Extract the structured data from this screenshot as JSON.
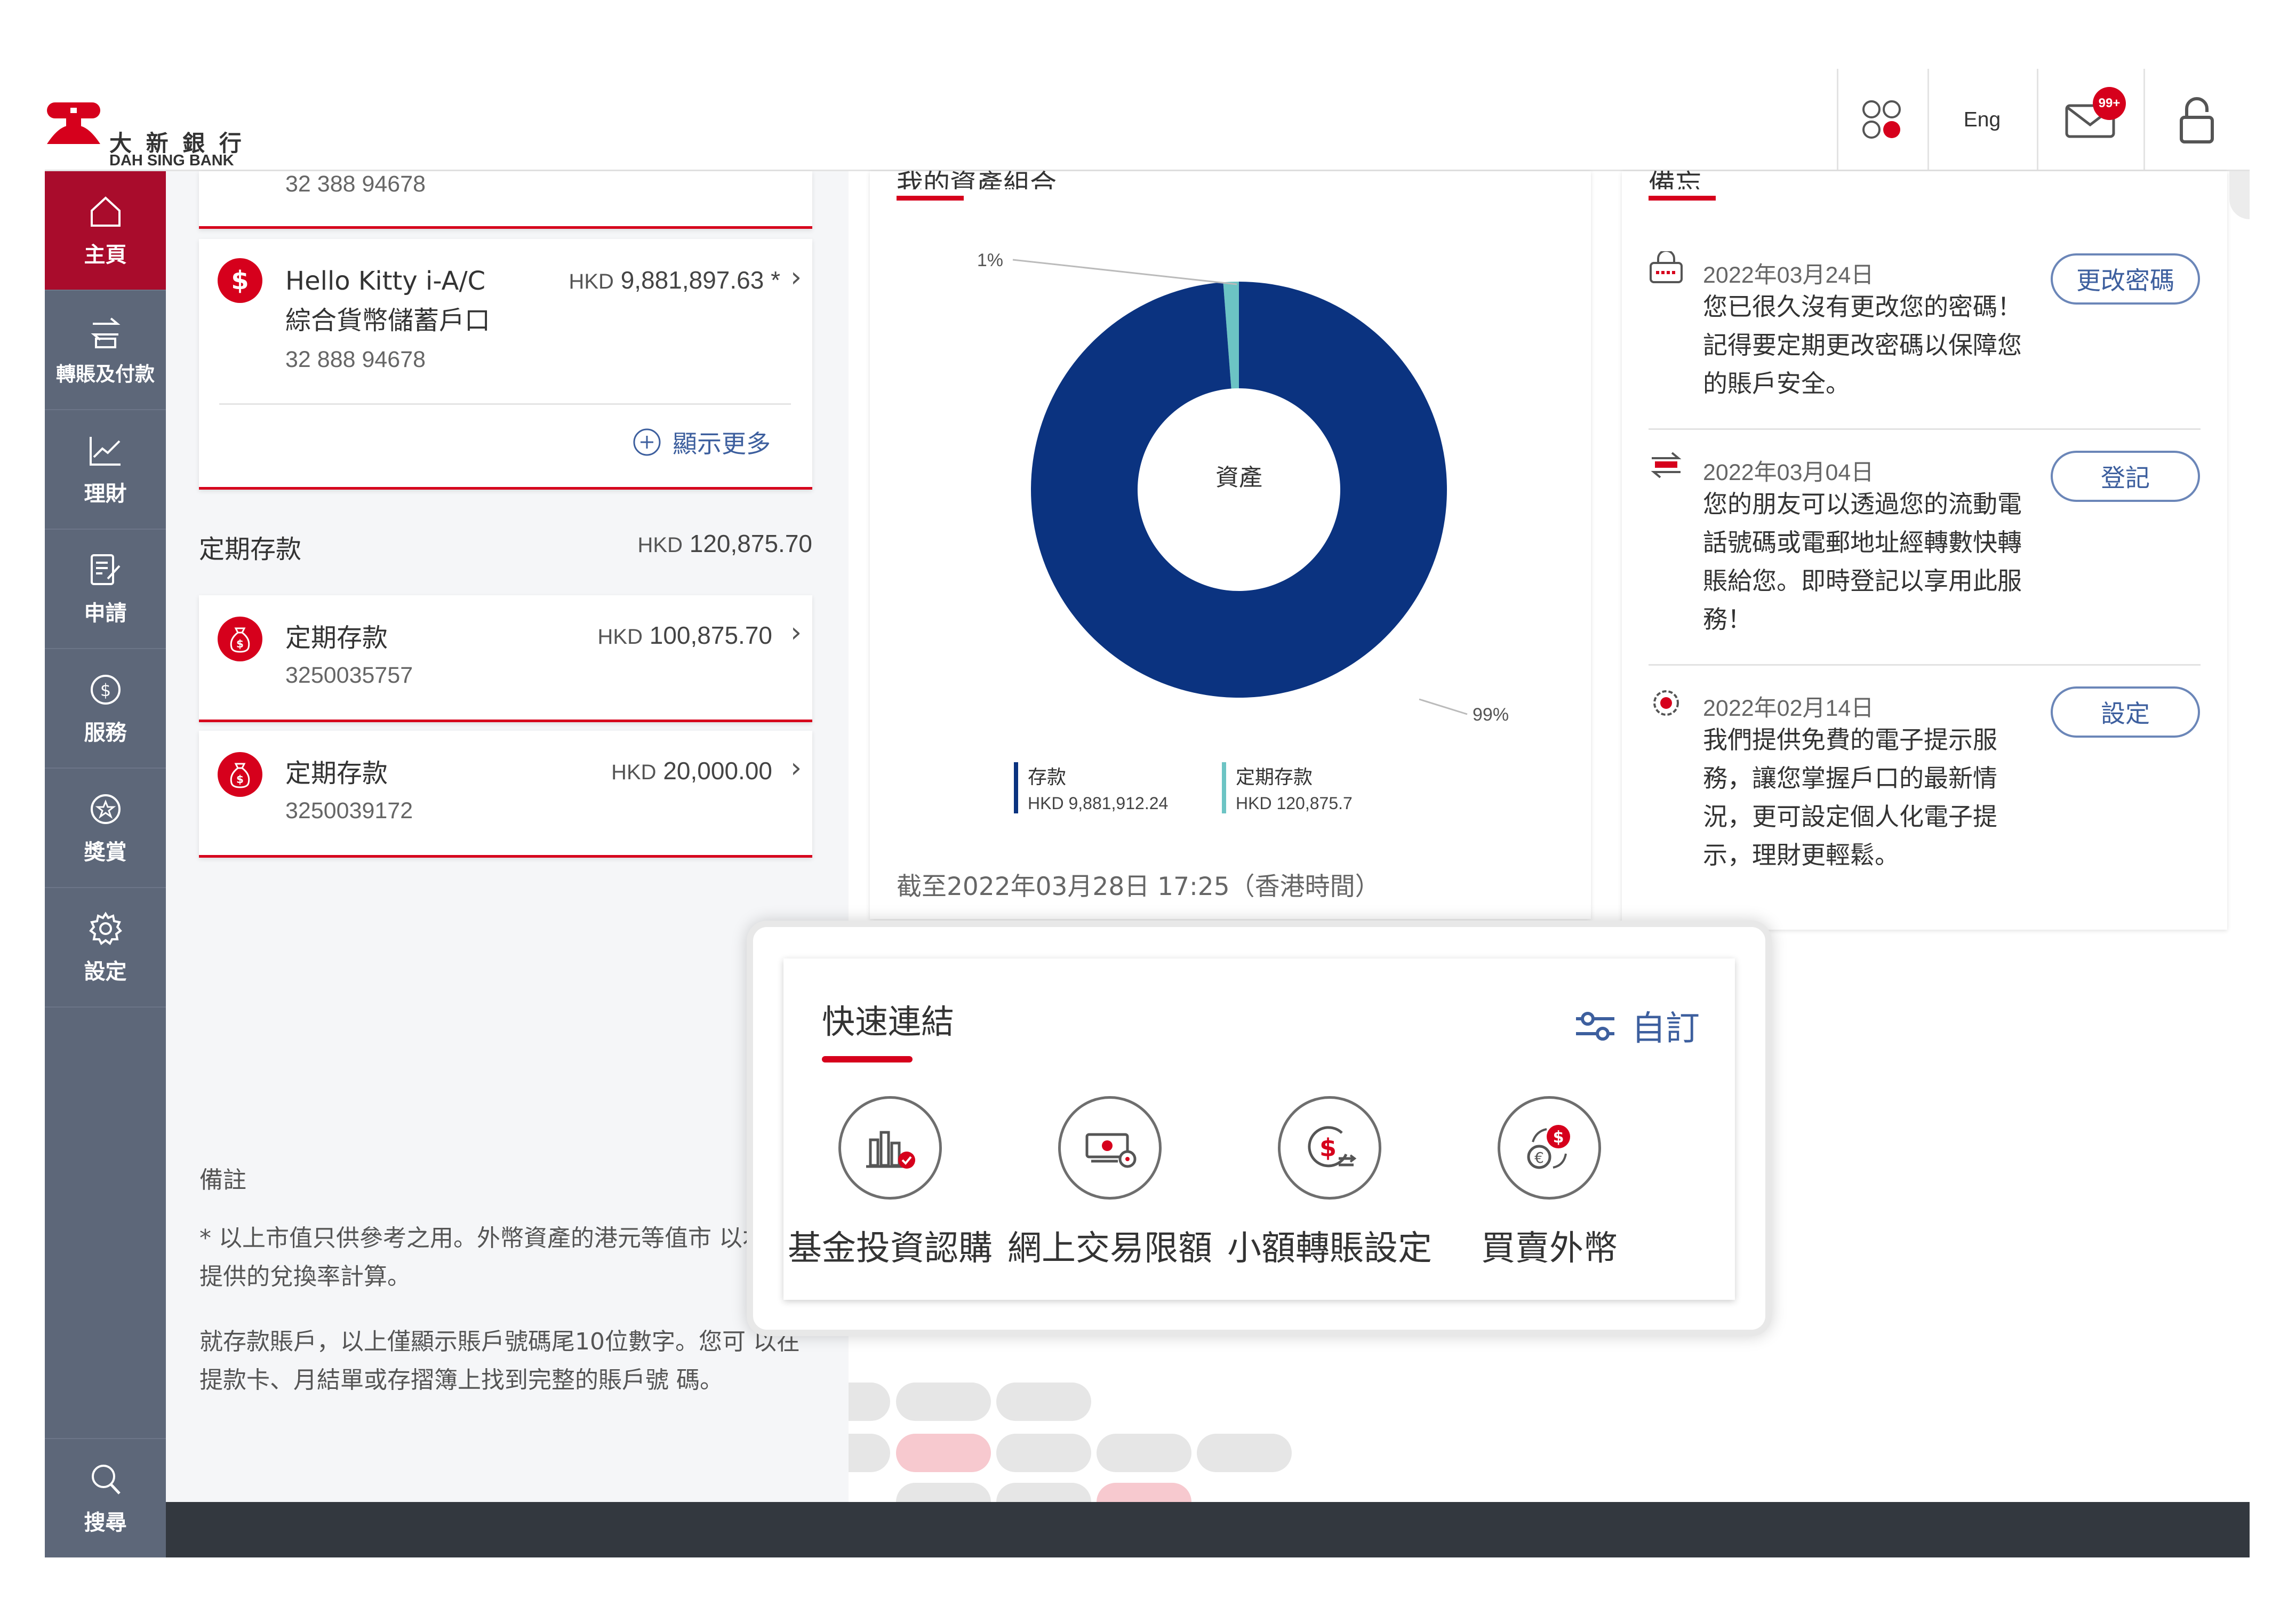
{
  "brand": {
    "name_zh": "大 新 銀 行",
    "name_en": "DAH SING BANK",
    "logo_color": "#d6001c"
  },
  "header": {
    "lang_label": "Eng",
    "msg_badge": "99+",
    "apps_icon": "apps-grid-icon",
    "msg_icon": "envelope-icon",
    "lock_icon": "lock-icon"
  },
  "sidebar": {
    "items": [
      {
        "label": "主頁",
        "icon": "home-icon",
        "active": true
      },
      {
        "label": "轉賬及付款",
        "icon": "transfer-icon"
      },
      {
        "label": "理財",
        "icon": "chart-line-icon"
      },
      {
        "label": "申請",
        "icon": "application-form-icon"
      },
      {
        "label": "服務",
        "icon": "dollar-circle-icon"
      },
      {
        "label": "獎賞",
        "icon": "star-circle-icon"
      },
      {
        "label": "設定",
        "icon": "gear-icon"
      }
    ],
    "search_label": "搜尋"
  },
  "accounts": {
    "top_partial": {
      "number": "32 388 94678"
    },
    "hello_kitty": {
      "name": "Hello Kitty i-A/C 綜合貨幣儲蓄戶口",
      "currency": "HKD",
      "amount": "9,881,897.63",
      "suffix": "*",
      "number": "32 888 94678"
    },
    "show_more": "顯示更多"
  },
  "time_deposit": {
    "section_title": "定期存款",
    "total_currency": "HKD",
    "total_amount": "120,875.70",
    "items": [
      {
        "title": "定期存款",
        "currency": "HKD",
        "amount": "100,875.70",
        "number": "3250035757"
      },
      {
        "title": "定期存款",
        "currency": "HKD",
        "amount": "20,000.00",
        "number": "3250039172"
      }
    ]
  },
  "notes": {
    "title": "備註",
    "p1": "* 以上市值只供參考之用。外幣資產的港元等值市 以本行所提供的兌換率計算。",
    "p2": "就存款賬戶，以上僅顯示賬戶號碼尾10位數字。您可 以在提款卡、月結單或存摺簿上找到完整的賬戶號 碼。"
  },
  "chart_panel": {
    "title_partial": "我的資產組合",
    "center_label": "資產",
    "as_of": "截至2022年03月28日 17:25（香港時間）"
  },
  "chart_data": {
    "type": "pie",
    "center_label": "資產",
    "series": [
      {
        "name": "存款",
        "display": "HKD 9,881,912.24",
        "value": 9881912.24,
        "percent_label": "99%",
        "color": "#0b3380"
      },
      {
        "name": "定期存款",
        "display": "HKD 120,875.7",
        "value": 120875.7,
        "percent_label": "1%",
        "color": "#6cc4c4"
      }
    ]
  },
  "reminders": {
    "title_partial": "備忘",
    "items": [
      {
        "date": "2022年03月24日",
        "text": "您已很久沒有更改您的密碼！記得要定期更改密碼以保障您的賬戶安全。",
        "button": "更改密碼",
        "icon": "password-icon"
      },
      {
        "date": "2022年03月04日",
        "text": "您的朋友可以透過您的流動電話號碼或電郵地址經轉數快轉賬給您。即時登記以享用此服務！",
        "button": "登記",
        "icon": "transfer-arrows-icon"
      },
      {
        "date": "2022年02月14日",
        "text": "我們提供免費的電子提示服務，讓您掌握戶口的最新情況，更可設定個人化電子提示，理財更輕鬆。",
        "button": "設定",
        "icon": "notification-gear-icon"
      }
    ]
  },
  "quick_links": {
    "title": "快速連結",
    "customize": "自訂",
    "items": [
      {
        "label": "基金投資認購",
        "icon": "fund-chart-icon"
      },
      {
        "label": "網上交易限額",
        "icon": "transaction-limit-icon"
      },
      {
        "label": "小額轉賬設定",
        "icon": "small-transfer-icon"
      },
      {
        "label": "買賣外幣",
        "icon": "currency-exchange-icon"
      }
    ]
  }
}
